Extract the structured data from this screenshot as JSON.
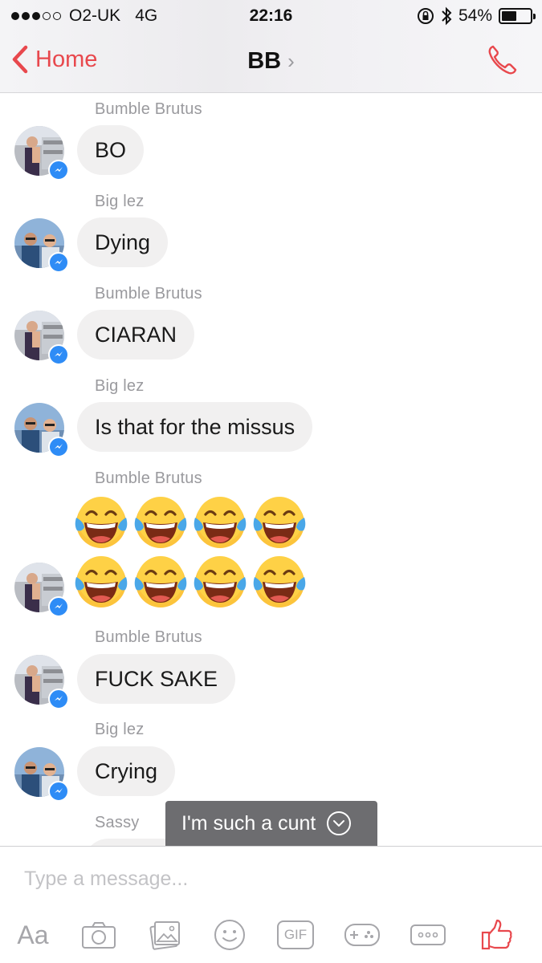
{
  "status_bar": {
    "carrier": "O2-UK",
    "network": "4G",
    "time": "22:16",
    "battery": "54%",
    "battery_level": 0.54
  },
  "nav": {
    "back_label": "Home",
    "title": "BB",
    "chevron": "›"
  },
  "messages": [
    {
      "sender": "Bumble Brutus",
      "text": "BO"
    },
    {
      "sender": "Big lez",
      "text": "Dying"
    },
    {
      "sender": "Bumble Brutus",
      "text": "CIARAN"
    },
    {
      "sender": "Big lez",
      "text": "Is that for the missus"
    },
    {
      "sender": "Bumble Brutus",
      "emoji": "face-with-tears-of-joy",
      "emoji_count": 8
    },
    {
      "sender": "Bumble Brutus",
      "text": "FUCK SAKE"
    },
    {
      "sender": "Big lez",
      "text": "Crying"
    },
    {
      "sender": "Sassy"
    }
  ],
  "new_message_toast": "I'm such a cunt",
  "composer": {
    "placeholder": "Type a message...",
    "aa_label": "Aa",
    "gif_label": "GIF"
  },
  "colors": {
    "accent": "#e8484d",
    "bubble": "#f1f0f0",
    "messenger_badge": "#2e8cf6",
    "toast": "#6d6d70"
  }
}
